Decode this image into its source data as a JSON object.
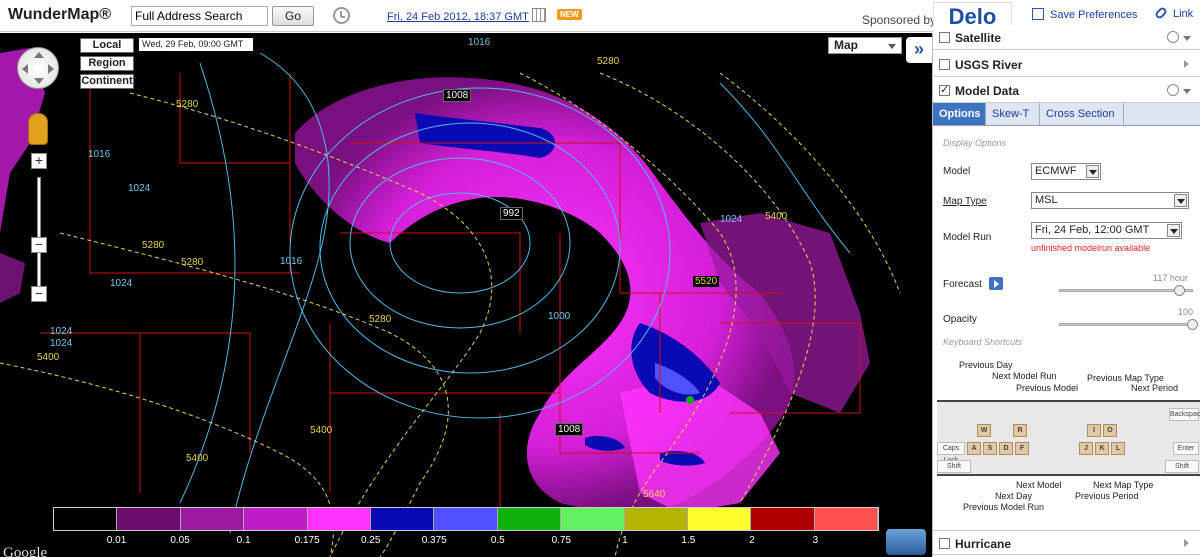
{
  "app": {
    "title": "WunderMap®"
  },
  "search": {
    "value": "Full Address Search",
    "go_label": "Go"
  },
  "header": {
    "date_link": "Fri, 24 Feb 2012, 18:37 GMT",
    "new_badge": "NEW",
    "sponsor_label": "Sponsored by:",
    "sponsor_name": "Delo",
    "save_preferences": "Save Preferences",
    "link_label": "Link"
  },
  "map": {
    "scale_buttons": [
      "Local",
      "Region",
      "Continent"
    ],
    "valid_time": "Wed, 29 Feb, 09:00 GMT",
    "map_type": "Map",
    "collapse_label": "»",
    "google_label": "Google",
    "zoom_in": "+",
    "zoom_out_1": "−",
    "zoom_out_2": "−",
    "pressure_labels": [
      "1008",
      "992",
      "1000",
      "1008",
      "1016",
      "1016",
      "1016",
      "1024",
      "1024",
      "1024",
      "1024",
      "1024"
    ],
    "height_labels": [
      "5280",
      "5280",
      "5280",
      "5280",
      "5280",
      "5400",
      "5400",
      "5400",
      "5400",
      "5520",
      "5640"
    ]
  },
  "legend": {
    "labels": [
      "0.01",
      "0.05",
      "0.1",
      "0.175",
      "0.25",
      "0.375",
      "0.5",
      "0.75",
      "1",
      "1.5",
      "2",
      "3"
    ],
    "colors": [
      "#000000",
      "#6b0c6b",
      "#9a1aa0",
      "#c01cc8",
      "#ff33ff",
      "#0a0ab4",
      "#5050ff",
      "#10b010",
      "#60f060",
      "#b4b400",
      "#ffff30",
      "#b00000",
      "#ff5050"
    ]
  },
  "layers": {
    "satellite": {
      "label": "Satellite",
      "checked": false
    },
    "usgs_river": {
      "label": "USGS River",
      "checked": false
    },
    "model_data": {
      "label": "Model Data",
      "checked": true
    },
    "hurricane": {
      "label": "Hurricane",
      "checked": false
    }
  },
  "tabs": [
    "Options",
    "Skew-T",
    "Cross Section"
  ],
  "options": {
    "display_options_title": "Display Options",
    "model_label": "Model",
    "model_value": "ECMWF",
    "map_type_label": "Map Type",
    "map_type_value": "MSL",
    "model_run_label": "Model Run",
    "model_run_value": "Fri, 24 Feb, 12:00 GMT",
    "model_run_warning": "unfinished modelrun available",
    "forecast_label": "Forecast",
    "forecast_value": "117 hour",
    "forecast_fraction": 0.9,
    "opacity_label": "Opacity",
    "opacity_value": "100",
    "opacity_fraction": 1.0,
    "keyboard_title": "Keyboard Shortcuts"
  },
  "keyboard": {
    "top_labels": [
      "Previous Day",
      "Next Model Run",
      "Previous Model",
      "Previous Map Type",
      "Next Period"
    ],
    "bottom_labels": [
      "Next Model",
      "Next Day",
      "Previous Model Run",
      "Next Map Type",
      "Previous Period"
    ],
    "keys_top": [
      "W",
      "R",
      "I",
      "O"
    ],
    "keys_mid": [
      "A",
      "S",
      "D",
      "F",
      "J",
      "K",
      "L"
    ],
    "extra_keys": [
      "Backspace",
      "Enter",
      "Shift",
      "Caps Lock",
      "Shift"
    ]
  },
  "colors": {
    "accent": "#3d74c2",
    "link": "#1a3e9e",
    "warning": "#dd2222"
  }
}
